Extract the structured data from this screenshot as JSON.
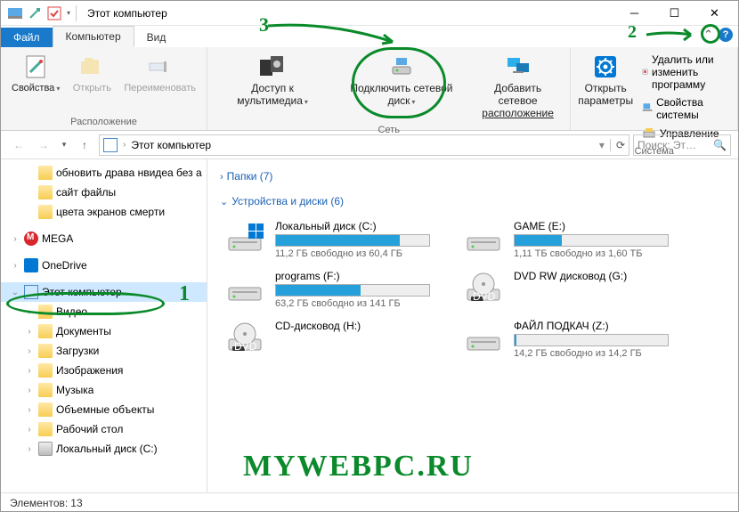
{
  "window": {
    "title": "Этот компьютер"
  },
  "tabs": {
    "file": "Файл",
    "computer": "Компьютер",
    "view": "Вид"
  },
  "ribbon": {
    "location": {
      "properties": "Свойства",
      "open": "Открыть",
      "rename": "Переименовать",
      "group": "Расположение"
    },
    "network": {
      "media": "Доступ к мультимедиа",
      "mapdrive": "Подключить сетевой диск",
      "addloc_l1": "Добавить сетевое",
      "addloc_l2": "расположение",
      "group": "Сеть"
    },
    "system": {
      "settings": "Открыть параметры",
      "uninstall": "Удалить или изменить программу",
      "props": "Свойства системы",
      "manage": "Управление",
      "group": "Система"
    }
  },
  "nav": {
    "crumb": "Этот компьютер",
    "search_placeholder": "Поиск: Эт…"
  },
  "tree": [
    {
      "label": "обновить драва нвидеа без а",
      "icon": "folder",
      "exp": "",
      "lvl": 2
    },
    {
      "label": "сайт файлы",
      "icon": "folder",
      "exp": "",
      "lvl": 2
    },
    {
      "label": "цвета экранов смерти",
      "icon": "folder",
      "exp": "",
      "lvl": 2
    },
    {
      "label": "MEGA",
      "icon": "mega",
      "exp": "›",
      "lvl": 1,
      "spacer": true
    },
    {
      "label": "OneDrive",
      "icon": "onedrive",
      "exp": "›",
      "lvl": 1,
      "spacer": true
    },
    {
      "label": "Этот компьютер",
      "icon": "pc",
      "exp": "⌄",
      "lvl": 1,
      "selected": true,
      "spacer": true
    },
    {
      "label": "Видео",
      "icon": "folder",
      "exp": "›",
      "lvl": 2
    },
    {
      "label": "Документы",
      "icon": "folder",
      "exp": "›",
      "lvl": 2
    },
    {
      "label": "Загрузки",
      "icon": "folder",
      "exp": "›",
      "lvl": 2
    },
    {
      "label": "Изображения",
      "icon": "folder",
      "exp": "›",
      "lvl": 2
    },
    {
      "label": "Музыка",
      "icon": "folder",
      "exp": "›",
      "lvl": 2
    },
    {
      "label": "Объемные объекты",
      "icon": "folder",
      "exp": "›",
      "lvl": 2
    },
    {
      "label": "Рабочий стол",
      "icon": "folder",
      "exp": "›",
      "lvl": 2
    },
    {
      "label": "Локальный диск (C:)",
      "icon": "hdd",
      "exp": "›",
      "lvl": 2
    }
  ],
  "content": {
    "folders_h": "Папки (7)",
    "devices_h": "Устройства и диски (6)",
    "devices": [
      {
        "name": "Локальный диск (C:)",
        "free": "11,2 ГБ свободно из 60,4 ГБ",
        "pct": 81,
        "type": "hdd",
        "oslogo": true
      },
      {
        "name": "GAME (E:)",
        "free": "1,11 ТБ свободно из 1,60 ТБ",
        "pct": 31,
        "type": "hdd"
      },
      {
        "name": "programs (F:)",
        "free": "63,2 ГБ свободно из 141 ГБ",
        "pct": 55,
        "type": "hdd"
      },
      {
        "name": "DVD RW дисковод (G:)",
        "free": "",
        "pct": null,
        "type": "dvd"
      },
      {
        "name": "CD-дисковод (H:)",
        "free": "",
        "pct": null,
        "type": "dvd"
      },
      {
        "name": "ФАЙЛ ПОДКАЧ (Z:)",
        "free": "14,2 ГБ свободно из 14,2 ГБ",
        "pct": 1,
        "type": "hdd"
      }
    ]
  },
  "status": {
    "label": "Элементов:",
    "count": "13"
  },
  "annotations": {
    "n1": "1",
    "n2": "2",
    "n3": "3",
    "watermark": "MYWEBPC.RU"
  }
}
